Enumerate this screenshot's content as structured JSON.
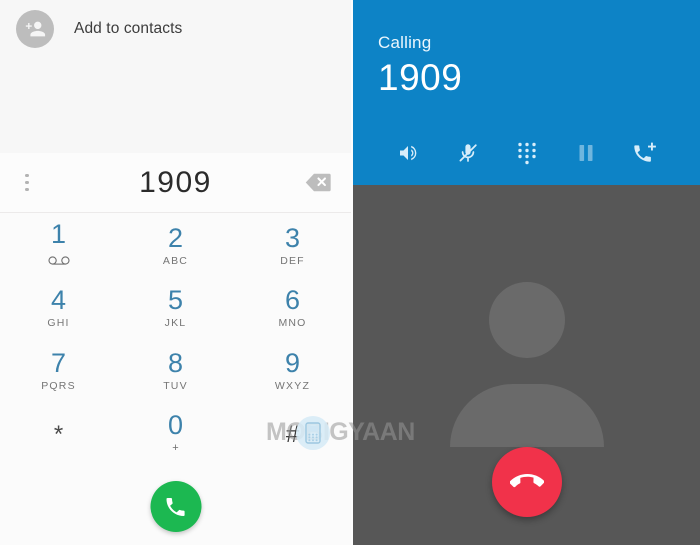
{
  "dialer": {
    "contact_action": {
      "label": "Add to contacts",
      "icon": "person-add-icon"
    },
    "overflow_menu_icon": "more-vert-icon",
    "entered_number": "1909",
    "backspace_icon": "backspace-icon",
    "keys": [
      {
        "digit": "1",
        "sub": "",
        "icon": "voicemail-icon"
      },
      {
        "digit": "2",
        "sub": "ABC",
        "icon": ""
      },
      {
        "digit": "3",
        "sub": "DEF",
        "icon": ""
      },
      {
        "digit": "4",
        "sub": "GHI",
        "icon": ""
      },
      {
        "digit": "5",
        "sub": "JKL",
        "icon": ""
      },
      {
        "digit": "6",
        "sub": "MNO",
        "icon": ""
      },
      {
        "digit": "7",
        "sub": "PQRS",
        "icon": ""
      },
      {
        "digit": "8",
        "sub": "TUV",
        "icon": ""
      },
      {
        "digit": "9",
        "sub": "WXYZ",
        "icon": ""
      },
      {
        "digit": "*",
        "sub": "",
        "icon": ""
      },
      {
        "digit": "0",
        "sub": "+",
        "icon": ""
      },
      {
        "digit": "#",
        "sub": "",
        "icon": ""
      }
    ],
    "call_button": {
      "icon": "phone-icon",
      "color": "#1cb851"
    },
    "digit_color": "#3d82ab",
    "letter_color": "#757575"
  },
  "in_call": {
    "status": "Calling",
    "number": "1909",
    "header_color": "#0d83c6",
    "background_color": "#575757",
    "actions": [
      {
        "name": "speaker-icon",
        "label": "Speaker",
        "state": "on"
      },
      {
        "name": "mic-off-icon",
        "label": "Mute",
        "state": "on"
      },
      {
        "name": "dialpad-icon",
        "label": "Keypad",
        "state": "on"
      },
      {
        "name": "pause-icon",
        "label": "Hold",
        "state": "disabled"
      },
      {
        "name": "add-call-icon",
        "label": "Add call",
        "state": "on"
      }
    ],
    "avatar_icon": "person-placeholder-icon",
    "end_call_button": {
      "icon": "call-end-icon",
      "color": "#f1324a"
    }
  },
  "watermark": {
    "text": "MOBIGYAAN",
    "badge_icon": "mobile-phone-icon"
  }
}
